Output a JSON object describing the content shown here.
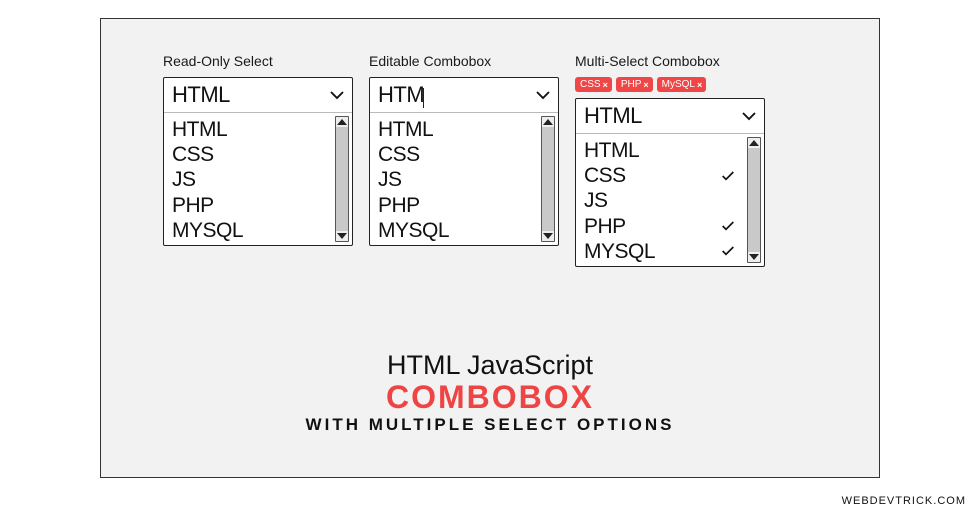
{
  "labels": {
    "readonly": "Read-Only Select",
    "editable": "Editable Combobox",
    "multi": "Multi-Select Combobox"
  },
  "readonly": {
    "value": "HTML",
    "options": [
      "HTML",
      "CSS",
      "JS",
      "PHP",
      "MYSQL"
    ]
  },
  "editable": {
    "value": "HTM",
    "options": [
      "HTML",
      "CSS",
      "JS",
      "PHP",
      "MYSQL"
    ]
  },
  "multi": {
    "value": "HTML",
    "tags": [
      "CSS",
      "PHP",
      "MySQL"
    ],
    "options": [
      {
        "label": "HTML",
        "checked": false
      },
      {
        "label": "CSS",
        "checked": true
      },
      {
        "label": "JS",
        "checked": false
      },
      {
        "label": "PHP",
        "checked": true
      },
      {
        "label": "MYSQL",
        "checked": true
      }
    ]
  },
  "hero": {
    "line1": "HTML JavaScript",
    "line2": "COMBOBOX",
    "line3": "WITH MULTIPLE SELECT OPTIONS"
  },
  "watermark": "WEBDEVTRICK.COM",
  "tag_close": "×"
}
